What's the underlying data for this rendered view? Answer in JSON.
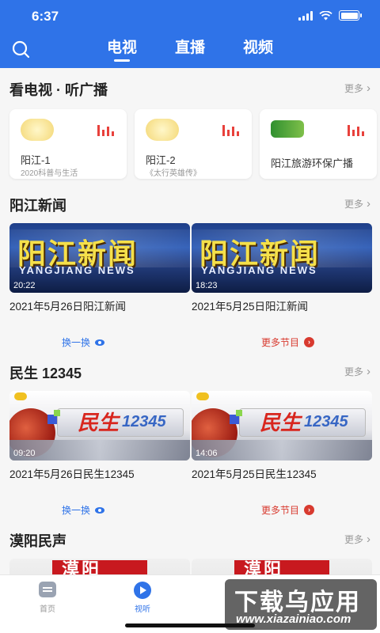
{
  "status_bar": {
    "time": "6:37"
  },
  "header": {
    "tabs": [
      {
        "label": "电视",
        "active": true
      },
      {
        "label": "直播",
        "active": false
      },
      {
        "label": "视频",
        "active": false
      }
    ]
  },
  "colors": {
    "brand_blue": "#2f73e8",
    "accent_red": "#d83a2f"
  },
  "radio_section": {
    "title": "看电视 · 听广播",
    "more_label": "更多",
    "stations": [
      {
        "name": "阳江-1",
        "subtitle": "2020科普与生活"
      },
      {
        "name": "阳江-2",
        "subtitle": "《太行英雄传》"
      },
      {
        "name": "阳江旅游环保广播",
        "subtitle": ""
      }
    ]
  },
  "news_section": {
    "title": "阳江新闻",
    "more_label": "更多",
    "thumb_cn": "阳江新闻",
    "thumb_en": "YANGJIANG NEWS",
    "videos": [
      {
        "title": "2021年5月26日阳江新闻",
        "duration": "20:22"
      },
      {
        "title": "2021年5月25日阳江新闻",
        "duration": "18:23"
      }
    ],
    "swap_label": "换一换",
    "more_programs_label": "更多节目"
  },
  "minsheng_section": {
    "title": "民生 12345",
    "more_label": "更多",
    "thumb_cn": "民生",
    "thumb_num": "12345",
    "videos": [
      {
        "title": "2021年5月26日民生12345",
        "duration": "09:20"
      },
      {
        "title": "2021年5月25日民生12345",
        "duration": "14:06"
      }
    ],
    "swap_label": "换一换",
    "more_programs_label": "更多节目"
  },
  "moyang_section": {
    "title": "漠阳民声",
    "more_label": "更多",
    "thumb_text": "漠阳"
  },
  "bottom_nav": {
    "items": [
      {
        "label": "首页",
        "icon": "home-icon",
        "active": false
      },
      {
        "label": "视听",
        "icon": "play-icon",
        "active": true
      }
    ]
  },
  "watermark": {
    "main": "下载乌应用",
    "url": "www.xiazainiao.com"
  }
}
